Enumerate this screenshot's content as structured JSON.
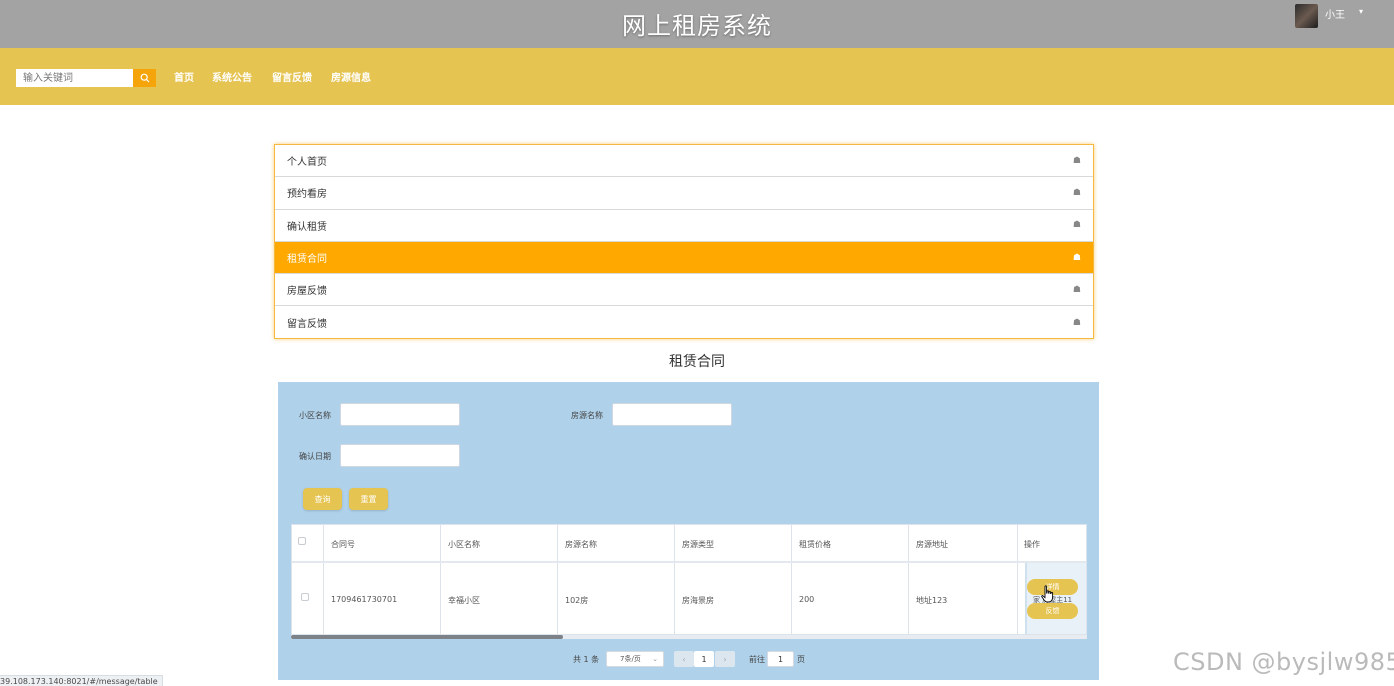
{
  "app": {
    "title": "网上租房系统",
    "user_name": "小王",
    "user_caret": "▾"
  },
  "nav": {
    "search_placeholder": "输入关键词",
    "search_icon": "search-icon",
    "items": [
      "首页",
      "系统公告",
      "留言反馈",
      "房源信息"
    ]
  },
  "menu": {
    "items": [
      {
        "label": "个人首页",
        "icon": "home-icon",
        "active": false
      },
      {
        "label": "预约看房",
        "icon": "home-icon",
        "active": false
      },
      {
        "label": "确认租赁",
        "icon": "home-icon",
        "active": false
      },
      {
        "label": "租赁合同",
        "icon": "home-icon",
        "active": true
      },
      {
        "label": "房屋反馈",
        "icon": "home-icon",
        "active": false
      },
      {
        "label": "留言反馈",
        "icon": "home-icon",
        "active": false
      }
    ],
    "active_color": "#ffa800"
  },
  "page": {
    "heading": "租赁合同"
  },
  "filters": {
    "community_label": "小区名称",
    "house_name_label": "房源名称",
    "confirm_date_label": "确认日期",
    "community_value": "",
    "house_name_value": "",
    "confirm_date_value": "",
    "query_button": "查询",
    "reset_button": "重置"
  },
  "table": {
    "headers": [
      "合同号",
      "小区名称",
      "房源名称",
      "房源类型",
      "租赁价格",
      "房源地址",
      "操作"
    ],
    "rows": [
      {
        "contract_no": "1709461730701",
        "community": "幸福小区",
        "house_name": "102房",
        "house_type": "房海景房",
        "price": "200",
        "address": "地址123",
        "detail_button": "详情",
        "feedback_button": "反馈",
        "op_text": "家 房屋主11"
      }
    ]
  },
  "pagination": {
    "total": "共 1 条",
    "page_size": "7条/页",
    "current_page": "1",
    "prev": "‹",
    "next": "›",
    "goto_label": "前往",
    "goto_value": "1",
    "page_unit": "页"
  },
  "status": {
    "url": "39.108.173.140:8021/#/message/table"
  },
  "watermark": "CSDN @bysjlw985",
  "colors": {
    "titlebar": "#a3a3a3",
    "navbar": "#e6c452",
    "panel": "#afd1ea",
    "accent": "#ffa800"
  }
}
